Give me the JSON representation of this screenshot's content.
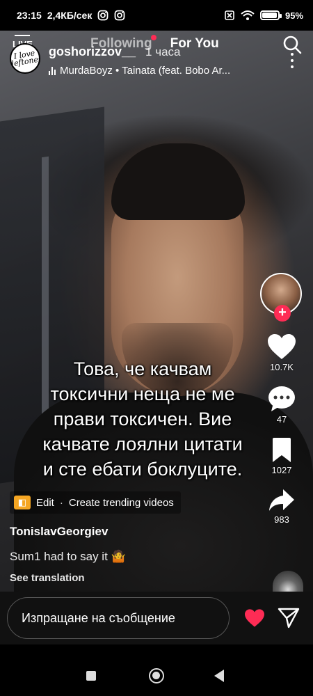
{
  "statusbar": {
    "time": "23:15",
    "speed": "2,4КБ/сек",
    "battery": "95",
    "battery_unit": "%",
    "battery_level": 0.95,
    "icons": [
      "instagram-icon",
      "instagram-icon",
      "no-sim-icon",
      "wifi-icon",
      "battery-icon"
    ]
  },
  "topnav": {
    "live_label": "LIVE",
    "tab_following": "Following",
    "tab_foryou": "For You"
  },
  "author": {
    "avatar_text": "i love deftones",
    "username": "goshorizzov__",
    "time": "1 часа",
    "music": "MurdaBoyz • Tainata (feat. Bobo Ar..."
  },
  "caption": {
    "lines": [
      "Това, че качвам",
      "токсични неща не ме",
      "прави токсичен. Вие",
      "качвате лоялни цитати",
      "и сте ебати боклуците."
    ]
  },
  "rail": {
    "likes": "10.7K",
    "comments": "47",
    "saves": "1027",
    "shares": "983"
  },
  "effect": {
    "edit": "Edit",
    "sep": "·",
    "label": "Create trending videos"
  },
  "post": {
    "handle": "TonislavGeorgiev",
    "description": "Sum1 had to say it 🤷",
    "see_translation": "See translation"
  },
  "composer": {
    "placeholder": "Изпращане на съобщение",
    "heart_color": "#fe2c55"
  },
  "colors": {
    "accent": "#fe2c55",
    "effect_badge": "#f5a623"
  }
}
